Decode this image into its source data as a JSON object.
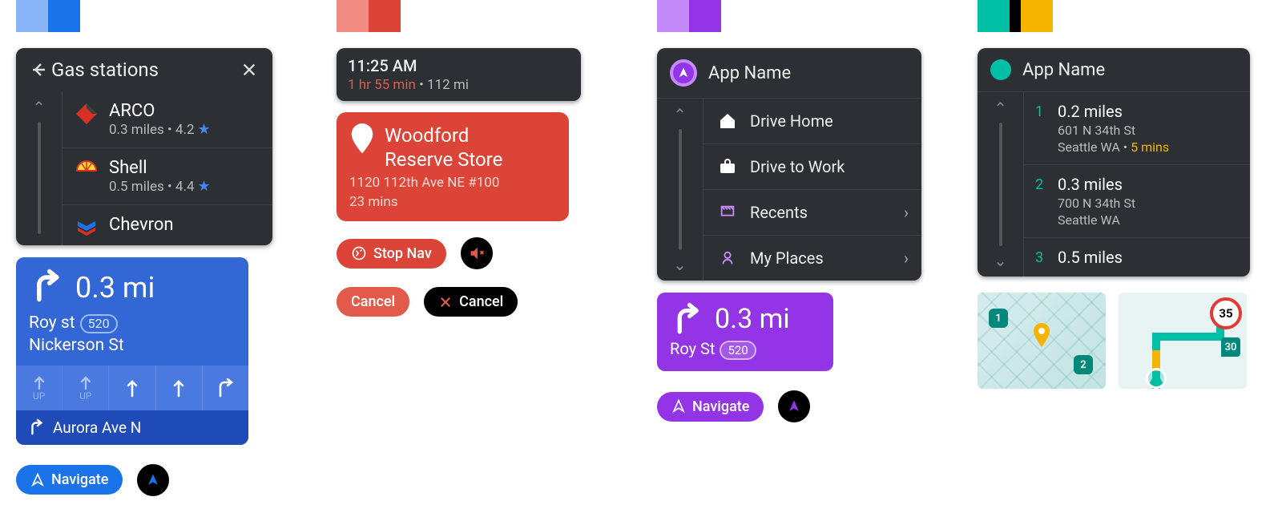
{
  "swatches": {
    "blue": [
      "#8ab4f8",
      "#1a73e8"
    ],
    "red": [
      "#f28b82",
      "#db4437"
    ],
    "purple": [
      "#c58af9",
      "#9334e6"
    ],
    "teal_amber": [
      "#00bfa5",
      "#f4b400"
    ]
  },
  "gas": {
    "title": "Gas stations",
    "items": [
      {
        "name": "ARCO",
        "sub": "0.3 miles • 4.2",
        "brand": "arco"
      },
      {
        "name": "Shell",
        "sub": "0.5 miles • 4.4",
        "brand": "shell"
      },
      {
        "name": "Chevron",
        "sub": "",
        "brand": "chevron"
      }
    ]
  },
  "turn_blue": {
    "distance": "0.3 mi",
    "line1_a": "Roy st",
    "line1_badge": "520",
    "line2": "Nickerson St",
    "lanes": [
      "UP",
      "UP",
      "up",
      "up",
      "right"
    ],
    "next": "Aurora Ave N"
  },
  "navigate_label": "Navigate",
  "status": {
    "clock": "11:25 AM",
    "eta": "1 hr 55 min",
    "dot": " • ",
    "distance": "112 mi"
  },
  "dest": {
    "name_l1": "Woodford",
    "name_l2": "Reserve Store",
    "address": "1120 112th Ave NE #100",
    "eta": "23 mins"
  },
  "btns": {
    "stop_nav": "Stop Nav",
    "cancel": "Cancel"
  },
  "app3": {
    "title": "App Name",
    "menu": [
      {
        "label": "Drive Home",
        "icon": "home"
      },
      {
        "label": "Drive to Work",
        "icon": "work"
      },
      {
        "label": "Recents",
        "icon": "recents",
        "chev": true
      },
      {
        "label": "My Places",
        "icon": "places",
        "chev": true
      }
    ]
  },
  "turn_purple": {
    "distance": "0.3 mi",
    "street": "Roy St",
    "badge": "520"
  },
  "app4": {
    "title": "App Name",
    "results": [
      {
        "n": "1",
        "t1": "0.2 miles",
        "addr": "601 N 34th St",
        "city": "Seattle WA",
        "extra": "5 mins"
      },
      {
        "n": "2",
        "t1": "0.3 miles",
        "addr": "700 N 34th St",
        "city": "Seattle WA"
      },
      {
        "n": "3",
        "t1": "0.5 miles"
      }
    ]
  },
  "minimap": {
    "pin1": "1",
    "pin2": "2",
    "speed": "35",
    "pin30": "30"
  }
}
